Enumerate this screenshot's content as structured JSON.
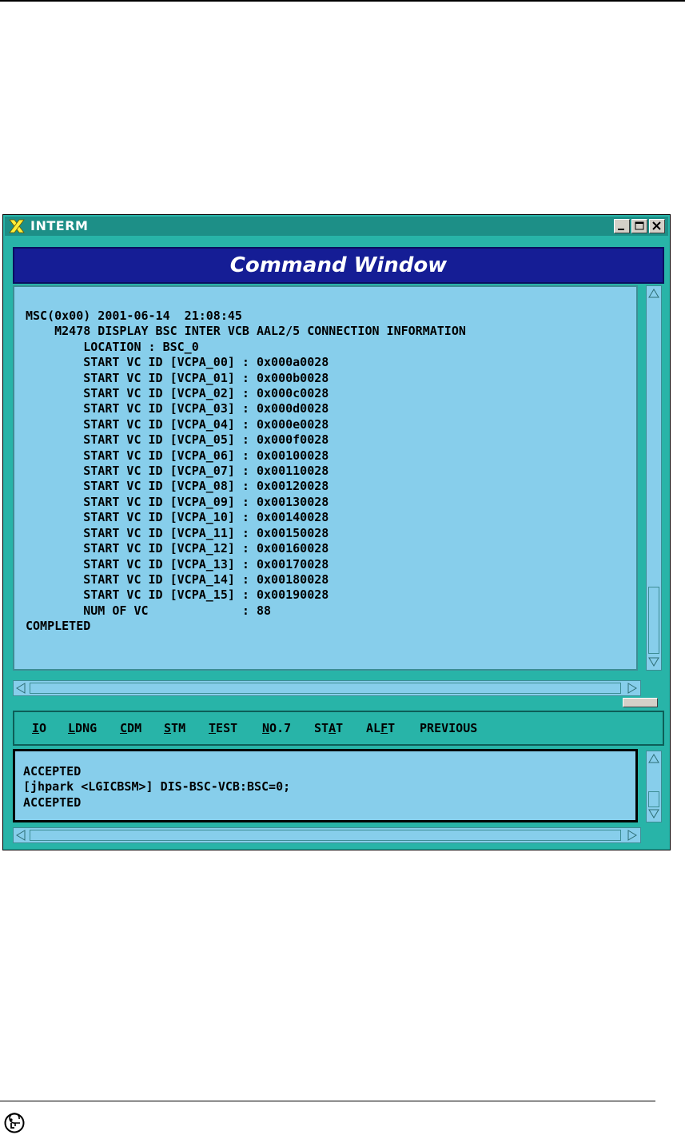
{
  "window": {
    "title": "INTERM",
    "banner_title": "Command Window"
  },
  "output": {
    "lines": [
      "MSC(0x00) 2001-06-14  21:08:45",
      "    M2478 DISPLAY BSC INTER VCB AAL2/5 CONNECTION INFORMATION",
      "        LOCATION : BSC_0",
      "        START VC ID [VCPA_00] : 0x000a0028",
      "        START VC ID [VCPA_01] : 0x000b0028",
      "        START VC ID [VCPA_02] : 0x000c0028",
      "        START VC ID [VCPA_03] : 0x000d0028",
      "        START VC ID [VCPA_04] : 0x000e0028",
      "        START VC ID [VCPA_05] : 0x000f0028",
      "        START VC ID [VCPA_06] : 0x00100028",
      "        START VC ID [VCPA_07] : 0x00110028",
      "        START VC ID [VCPA_08] : 0x00120028",
      "        START VC ID [VCPA_09] : 0x00130028",
      "        START VC ID [VCPA_10] : 0x00140028",
      "        START VC ID [VCPA_11] : 0x00150028",
      "        START VC ID [VCPA_12] : 0x00160028",
      "        START VC ID [VCPA_13] : 0x00170028",
      "        START VC ID [VCPA_14] : 0x00180028",
      "        START VC ID [VCPA_15] : 0x00190028",
      "        NUM OF VC             : 88",
      "COMPLETED"
    ]
  },
  "menu": {
    "items": [
      {
        "label": "IO",
        "underline_index": 0
      },
      {
        "label": "LDNG",
        "underline_index": 0
      },
      {
        "label": "CDM",
        "underline_index": 0
      },
      {
        "label": "STM",
        "underline_index": 0
      },
      {
        "label": "TEST",
        "underline_index": 0
      },
      {
        "label": "NO.7",
        "underline_index": 0
      },
      {
        "label": "STAT",
        "underline_index": 2
      },
      {
        "label": "ALFT",
        "underline_index": 2
      },
      {
        "label": "PREVIOUS",
        "underline_index": -1
      }
    ]
  },
  "input": {
    "lines": [
      "ACCEPTED",
      "[jhpark <LGICBSM>] DIS-BSC-VCB:BSC=0;",
      "ACCEPTED"
    ]
  },
  "colors": {
    "window_bg": "#28b4a8",
    "pane_bg": "#87ceeb",
    "banner_bg": "#151d95"
  },
  "icons": {
    "app": "x-logo-icon",
    "minimize": "minimize-icon",
    "maximize": "maximize-icon",
    "close": "close-icon",
    "footer": "lg-logo-icon"
  }
}
